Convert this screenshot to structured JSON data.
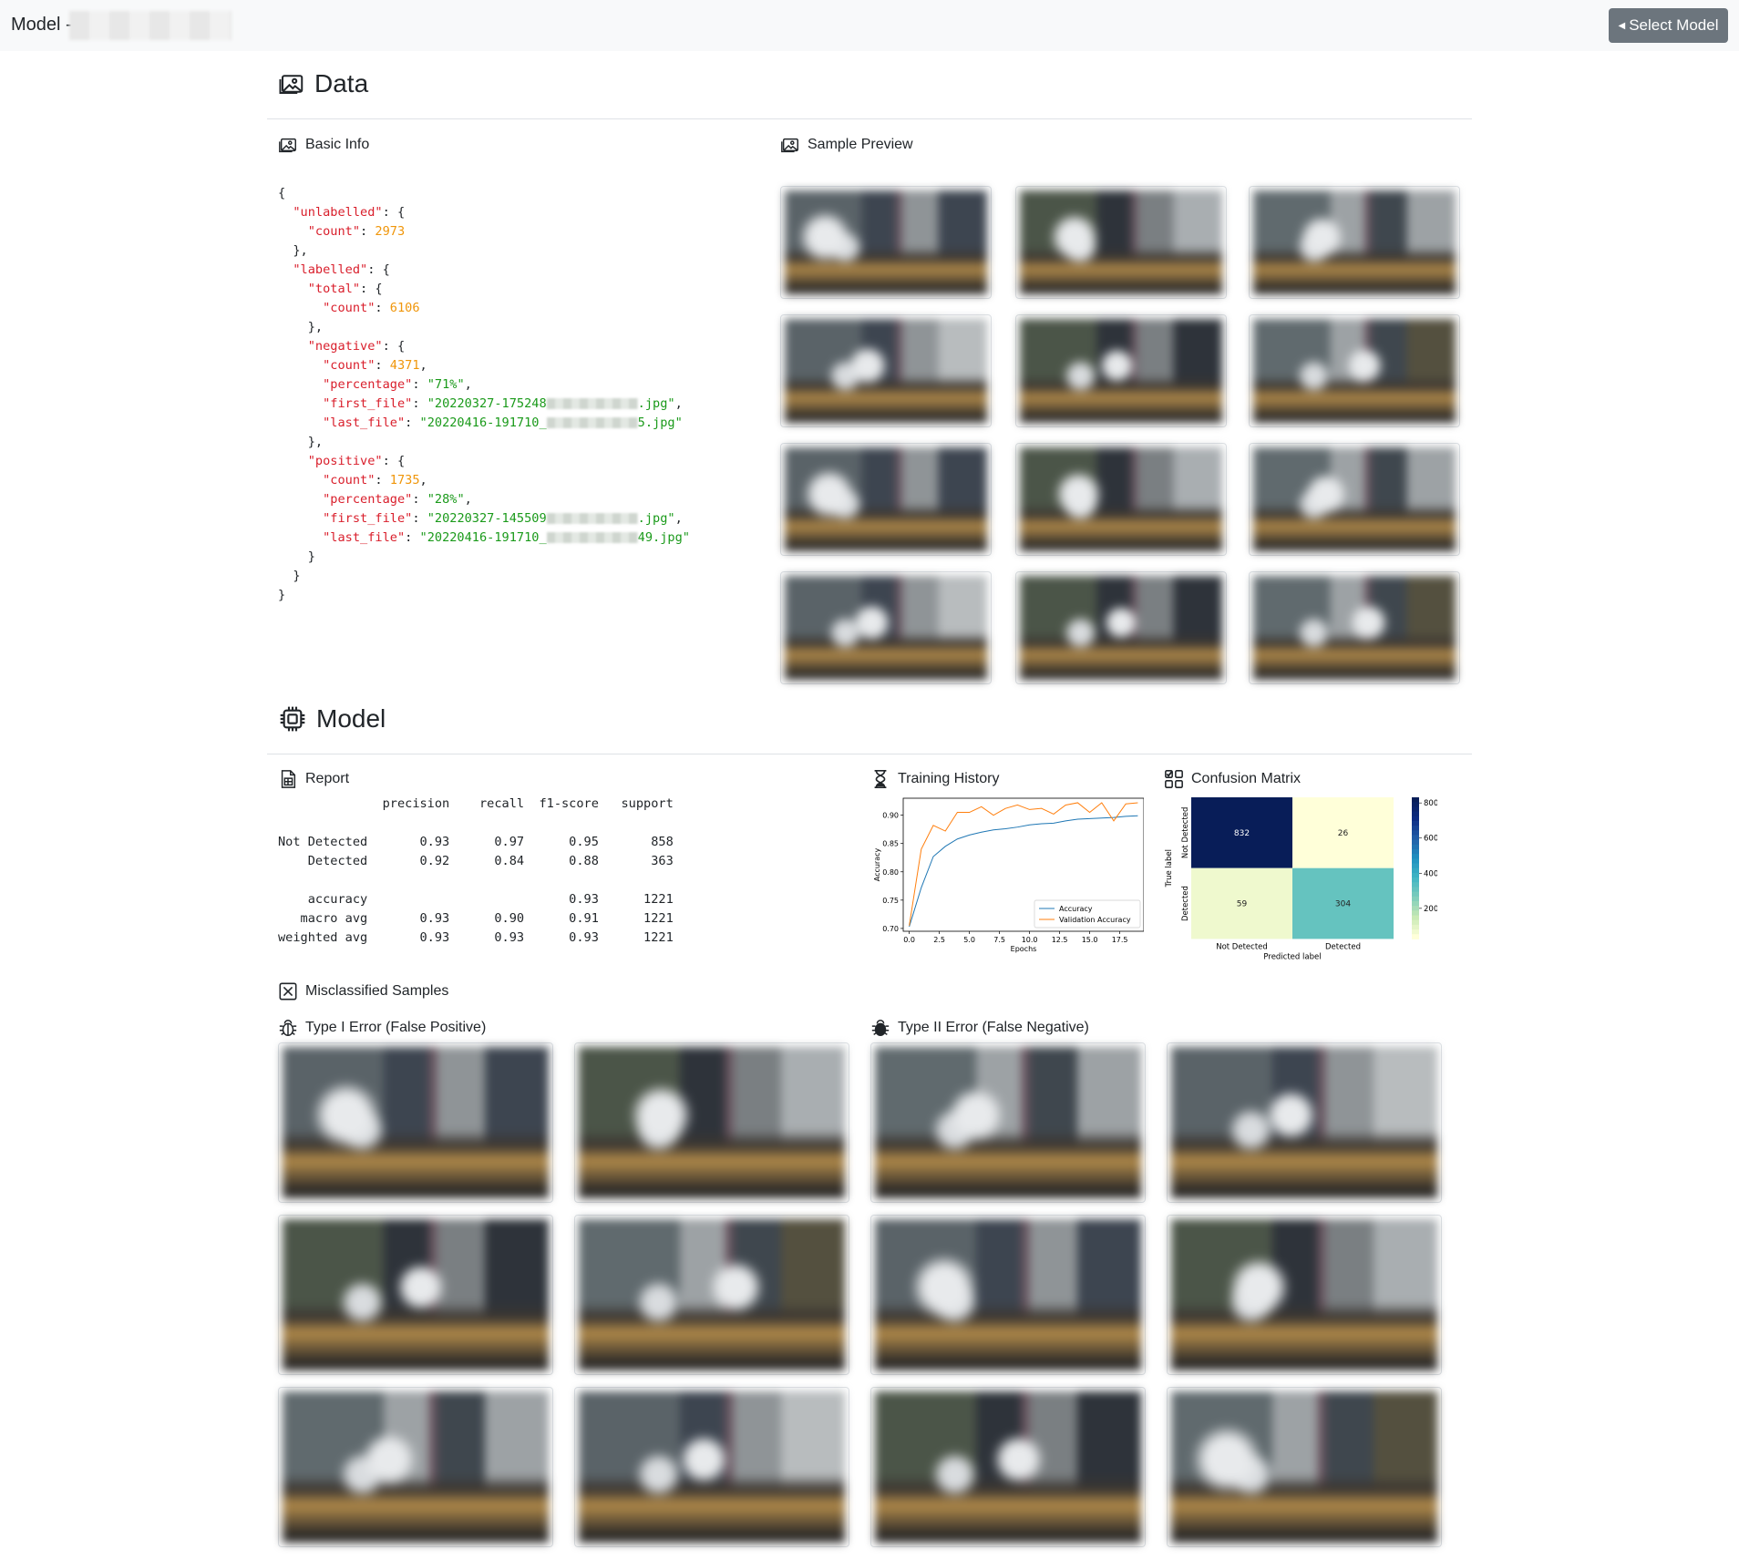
{
  "navbar": {
    "brand": "Model -",
    "select_button": "Select Model"
  },
  "data_section": {
    "title": "Data",
    "basic_info_title": "Basic Info",
    "sample_preview_title": "Sample Preview",
    "json_lines": {
      "unlabelled_count": "2973",
      "total_count": "6106",
      "negative_count": "4371",
      "negative_percentage": "\"71%\"",
      "negative_first_file_start": "\"20220327-175248",
      "negative_first_file_end": ".jpg\"",
      "negative_last_file_start": "\"20220416-191710_",
      "negative_last_file_end": "5.jpg\"",
      "positive_count": "1735",
      "positive_percentage": "\"28%\"",
      "positive_first_file_start": "\"20220327-145509",
      "positive_first_file_end": ".jpg\"",
      "positive_last_file_start": "\"20220416-191710_",
      "positive_last_file_end": "49.jpg\""
    }
  },
  "model_section": {
    "title": "Model",
    "report_title": "Report",
    "training_history_title": "Training History",
    "confusion_matrix_title": "Confusion Matrix",
    "misclassified_title": "Misclassified Samples",
    "type1_title": "Type I Error (False Positive)",
    "type2_title": "Type II Error (False Negative)",
    "report": {
      "headers": [
        "precision",
        "recall",
        "f1-score",
        "support"
      ],
      "rows": [
        {
          "label": "Not Detected",
          "values": [
            "0.93",
            "0.97",
            "0.95",
            "858"
          ]
        },
        {
          "label": "Detected",
          "values": [
            "0.92",
            "0.84",
            "0.88",
            "363"
          ]
        },
        {
          "label": "accuracy",
          "values": [
            "",
            "",
            "0.93",
            "1221"
          ]
        },
        {
          "label": "macro avg",
          "values": [
            "0.93",
            "0.90",
            "0.91",
            "1221"
          ]
        },
        {
          "label": "weighted avg",
          "values": [
            "0.93",
            "0.93",
            "0.93",
            "1221"
          ]
        }
      ]
    }
  },
  "chart_data": [
    {
      "type": "line",
      "xlabel": "Epochs",
      "ylabel": "Accuracy",
      "xlim": [
        -0.5,
        19.5
      ],
      "ylim": [
        0.695,
        0.93
      ],
      "xticks": [
        "0.0",
        "2.5",
        "5.0",
        "7.5",
        "10.0",
        "12.5",
        "15.0",
        "17.5"
      ],
      "yticks": [
        "0.70",
        "0.75",
        "0.80",
        "0.85",
        "0.90"
      ],
      "legend_position": "bottom-right",
      "x": [
        0,
        1,
        2,
        3,
        4,
        5,
        6,
        7,
        8,
        9,
        10,
        11,
        12,
        13,
        14,
        15,
        16,
        17,
        18,
        19
      ],
      "series": [
        {
          "name": "Accuracy",
          "color": "#1f77b4",
          "values": [
            0.703,
            0.772,
            0.827,
            0.845,
            0.858,
            0.865,
            0.87,
            0.874,
            0.876,
            0.879,
            0.883,
            0.885,
            0.886,
            0.89,
            0.893,
            0.894,
            0.895,
            0.896,
            0.898,
            0.899
          ]
        },
        {
          "name": "Validation Accuracy",
          "color": "#ff7f0e",
          "values": [
            0.705,
            0.84,
            0.882,
            0.872,
            0.905,
            0.905,
            0.915,
            0.9,
            0.912,
            0.918,
            0.91,
            0.912,
            0.902,
            0.918,
            0.922,
            0.905,
            0.922,
            0.89,
            0.92,
            0.922
          ]
        }
      ]
    },
    {
      "type": "heatmap",
      "xlabel": "Predicted label",
      "ylabel": "True label",
      "x_categories": [
        "Not Detected",
        "Detected"
      ],
      "y_categories": [
        "Not Detected",
        "Detected"
      ],
      "values": [
        [
          832,
          26
        ],
        [
          59,
          304
        ]
      ],
      "colorbar_ticks": [
        "800",
        "600",
        "400",
        "200"
      ],
      "colorbar_range": [
        26,
        832
      ]
    }
  ]
}
